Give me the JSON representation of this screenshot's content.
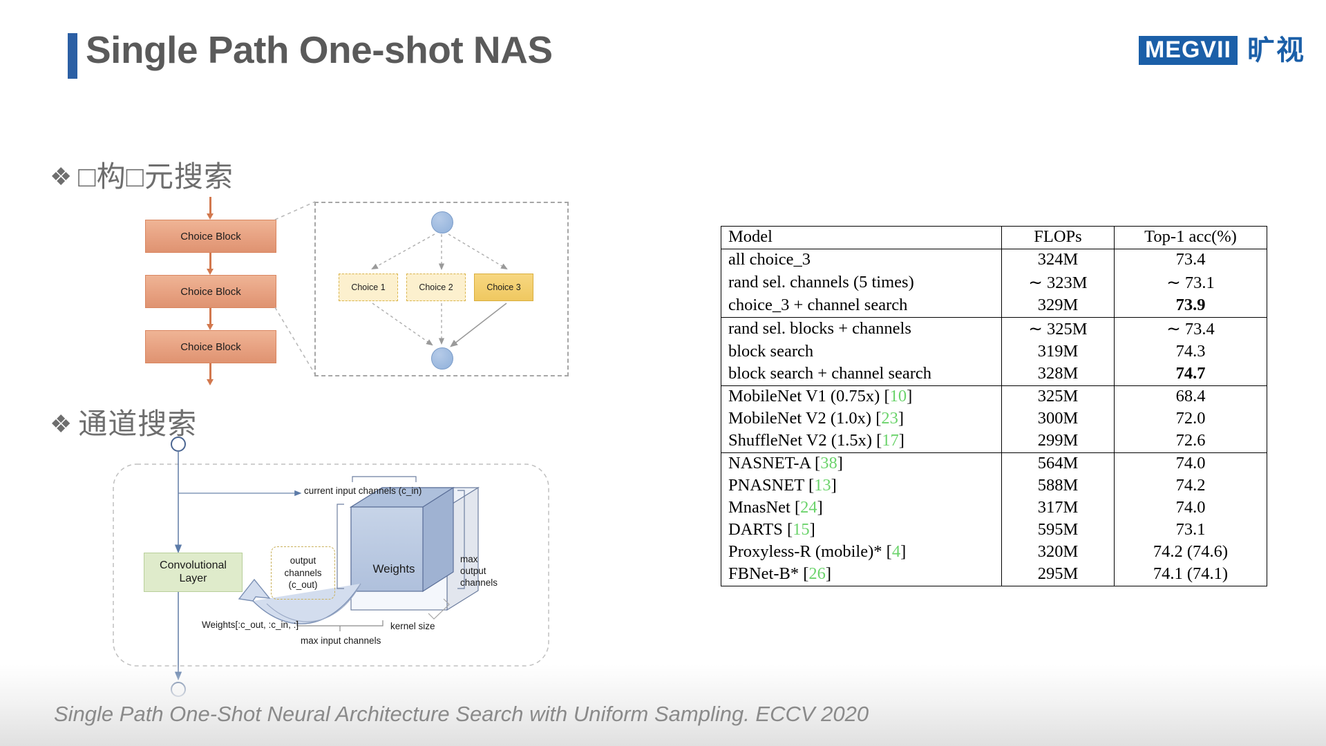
{
  "header": {
    "title": "Single Path One-shot NAS",
    "accent_color": "#2B5FA4",
    "logo_mark": "MEGVII",
    "logo_cn": "旷视",
    "logo_color": "#1B5FA8"
  },
  "bullets": [
    {
      "marker": "❖",
      "text": "□构□元搜索"
    },
    {
      "marker": "❖",
      "text": "通道搜索"
    }
  ],
  "diagram_blocks": {
    "blocks": [
      {
        "label": "Choice Block"
      },
      {
        "label": "Choice Block"
      },
      {
        "label": "Choice Block"
      }
    ],
    "block_color": "#E7A181"
  },
  "choices_panel": {
    "choices": [
      {
        "label": "Choice 1",
        "selected": false
      },
      {
        "label": "Choice 2",
        "selected": false
      },
      {
        "label": "Choice 3",
        "selected": true
      }
    ],
    "selected_color": "#EFC860",
    "unselected_color": "#FCF0CE",
    "node_color": "#8FB0DA"
  },
  "channel_diagram": {
    "conv_layer": "Convolutional Layer",
    "output_channels": "output channels (c_out)",
    "weights_box": "Weights",
    "current_input_channels": "current input channels (c_in)",
    "max_output_channels": "max output channels",
    "weights_slice": "Weights[:c_out, :c_in, :]",
    "max_input_channels": "max input channels",
    "kernel_size": "kernel size",
    "box_color": "#DFEBCB",
    "cube_color": "#BDCBE4"
  },
  "results_table": {
    "columns": [
      "Model",
      "FLOPs",
      "Top-1 acc(%)"
    ],
    "groups": [
      {
        "rows": [
          {
            "model": "all choice_3",
            "flops": "324M",
            "acc": "73.4",
            "acc_bold": false,
            "cite": ""
          },
          {
            "model": "rand sel. channels (5 times)",
            "flops": "∼ 323M",
            "acc": "∼ 73.1",
            "acc_bold": false,
            "cite": ""
          },
          {
            "model": "choice_3 + channel search",
            "flops": "329M",
            "acc": "73.9",
            "acc_bold": true,
            "cite": ""
          }
        ]
      },
      {
        "rows": [
          {
            "model": "rand sel. blocks + channels",
            "flops": "∼ 325M",
            "acc": "∼ 73.4",
            "acc_bold": false,
            "cite": ""
          },
          {
            "model": "block search",
            "flops": "319M",
            "acc": "74.3",
            "acc_bold": false,
            "cite": ""
          },
          {
            "model": "block search + channel search",
            "flops": "328M",
            "acc": "74.7",
            "acc_bold": true,
            "cite": ""
          }
        ]
      },
      {
        "rows": [
          {
            "model": "MobileNet V1 (0.75x) ",
            "cite": "10",
            "flops": "325M",
            "acc": "68.4",
            "acc_bold": false
          },
          {
            "model": "MobileNet V2 (1.0x) ",
            "cite": "23",
            "flops": "300M",
            "acc": "72.0",
            "acc_bold": false
          },
          {
            "model": "ShuffleNet V2 (1.5x) ",
            "cite": "17",
            "flops": "299M",
            "acc": "72.6",
            "acc_bold": false
          }
        ]
      },
      {
        "rows": [
          {
            "model": "NASNET-A ",
            "cite": "38",
            "flops": "564M",
            "acc": "74.0",
            "acc_bold": false
          },
          {
            "model": "PNASNET ",
            "cite": "13",
            "flops": "588M",
            "acc": "74.2",
            "acc_bold": false
          },
          {
            "model": "MnasNet ",
            "cite": "24",
            "flops": "317M",
            "acc": "74.0",
            "acc_bold": false
          },
          {
            "model": "DARTS ",
            "cite": "15",
            "flops": "595M",
            "acc": "73.1",
            "acc_bold": false
          },
          {
            "model": "Proxyless-R (mobile)* ",
            "cite": "4",
            "flops": "320M",
            "acc": "74.2 (74.6)",
            "acc_bold": false
          },
          {
            "model": "FBNet-B* ",
            "cite": "26",
            "flops": "295M",
            "acc": "74.1 (74.1)",
            "acc_bold": false
          }
        ]
      }
    ],
    "cite_color": "#6BD36B"
  },
  "footer": {
    "text": "Single Path One-Shot Neural Architecture Search with Uniform Sampling.  ECCV  2020"
  }
}
